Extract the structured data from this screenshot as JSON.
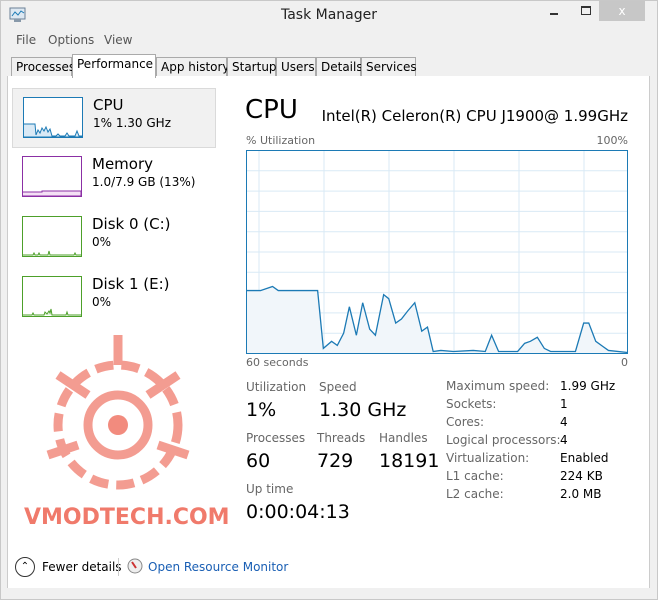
{
  "window": {
    "title": "Task Manager",
    "close": "x"
  },
  "menu": [
    "File",
    "Options",
    "View"
  ],
  "tabs": [
    "Processes",
    "Performance",
    "App history",
    "Startup",
    "Users",
    "Details",
    "Services"
  ],
  "sidebar": [
    {
      "name": "CPU",
      "value": "1% 1.30 GHz",
      "color": "#1c7ab5"
    },
    {
      "name": "Memory",
      "value": "1.0/7.9 GB (13%)",
      "color": "#8b2fa5"
    },
    {
      "name": "Disk 0 (C:)",
      "value": "0%",
      "color": "#4da02a"
    },
    {
      "name": "Disk 1 (E:)",
      "value": "0%",
      "color": "#4da02a"
    }
  ],
  "main": {
    "title": "CPU",
    "processor": "Intel(R) Celeron(R) CPU J1900@ 1.99GHz",
    "graph_label": "% Utilization",
    "graph_max": "100%",
    "graph_time": "60 seconds",
    "graph_min": "0"
  },
  "stats": {
    "utilization_label": "Utilization",
    "utilization": "1%",
    "speed_label": "Speed",
    "speed": "1.30 GHz",
    "processes_label": "Processes",
    "processes": "60",
    "threads_label": "Threads",
    "threads": "729",
    "handles_label": "Handles",
    "handles": "18191",
    "uptime_label": "Up time",
    "uptime": "0:00:04:13"
  },
  "specs": [
    {
      "k": "Maximum speed:",
      "v": "1.99 GHz"
    },
    {
      "k": "Sockets:",
      "v": "1"
    },
    {
      "k": "Cores:",
      "v": "4"
    },
    {
      "k": "Logical processors:",
      "v": "4"
    },
    {
      "k": "Virtualization:",
      "v": "Enabled"
    },
    {
      "k": "L1 cache:",
      "v": "224 KB"
    },
    {
      "k": "L2 cache:",
      "v": "2.0 MB"
    }
  ],
  "footer": {
    "fewer": "Fewer details",
    "monitor": "Open Resource Monitor"
  },
  "watermark": "VMODTECH.COM",
  "chart_data": {
    "type": "area",
    "title": "CPU % Utilization",
    "xlabel": "60 seconds",
    "ylabel": "% Utilization",
    "ylim": [
      0,
      100
    ],
    "xlim": [
      0,
      60
    ],
    "series": [
      {
        "name": "CPU",
        "color": "#1c7ab5",
        "points": [
          [
            0,
            31
          ],
          [
            2.2,
            31
          ],
          [
            4.1,
            33
          ],
          [
            5,
            31
          ],
          [
            11.2,
            31
          ],
          [
            12.1,
            2.5
          ],
          [
            13.4,
            6
          ],
          [
            14.3,
            4
          ],
          [
            15.3,
            10
          ],
          [
            16.2,
            23
          ],
          [
            17.3,
            9
          ],
          [
            18.3,
            25
          ],
          [
            19.4,
            12
          ],
          [
            20.3,
            9
          ],
          [
            21.6,
            29
          ],
          [
            22.4,
            27
          ],
          [
            23.5,
            15
          ],
          [
            24.4,
            17
          ],
          [
            25.4,
            21
          ],
          [
            26.5,
            25
          ],
          [
            27.6,
            11
          ],
          [
            28.5,
            13
          ],
          [
            29.4,
            1
          ],
          [
            30.6,
            1.5
          ],
          [
            32.6,
            1
          ],
          [
            35.7,
            1.5
          ],
          [
            37.6,
            1
          ],
          [
            38.6,
            9
          ],
          [
            39.7,
            1
          ],
          [
            42.7,
            1
          ],
          [
            43.8,
            5
          ],
          [
            44.7,
            6
          ],
          [
            45.8,
            8
          ],
          [
            46.9,
            2.5
          ],
          [
            47.9,
            1
          ],
          [
            51.8,
            1
          ],
          [
            53.1,
            15
          ],
          [
            53.9,
            15
          ],
          [
            55,
            6
          ],
          [
            56.1,
            3.5
          ],
          [
            57,
            1.5
          ],
          [
            60,
            0.5
          ]
        ]
      }
    ]
  }
}
